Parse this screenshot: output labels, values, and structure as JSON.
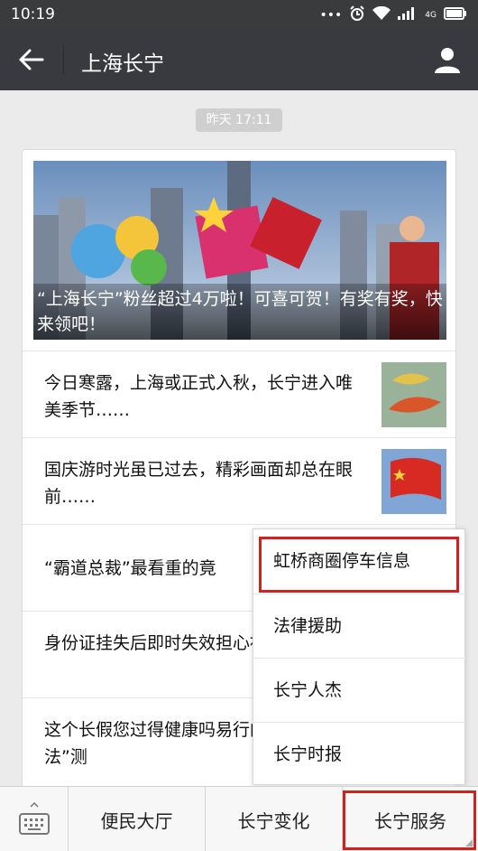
{
  "status_bar": {
    "time": "10:19",
    "icons": [
      "more-icon",
      "alarm-icon",
      "wifi-icon",
      "signal-icon",
      "battery-icon"
    ],
    "network": "4G"
  },
  "nav": {
    "title": "上海长宁"
  },
  "timestamp": "昨天 17:11",
  "banner": {
    "caption": "“上海长宁”粉丝超过4万啦！可喜可贺！有奖有奖，快来领吧！"
  },
  "articles": [
    {
      "title": "今日寒露，上海或正式入秋，长宁进入唯美季节……",
      "thumb": "autumn-leaf-thumbnail"
    },
    {
      "title": "国庆游时光虽已过去，精彩画面却总在眼前……",
      "thumb": "flag-thumbnail"
    },
    {
      "title": "“霸道总裁”最看重的竟"
    },
    {
      "title": "身份证挂失后即时失效担心被冒用啦~"
    },
    {
      "title": "这个长假您过得健康吗易行的“身体自检法”测"
    }
  ],
  "popup_menu": {
    "items": [
      "虹桥商圈停车信息",
      "法律援助",
      "长宁人杰",
      "长宁时报"
    ],
    "highlighted": 0
  },
  "bottom_menu": {
    "items": [
      "便民大厅",
      "长宁变化",
      "长宁服务"
    ],
    "highlighted": 2
  },
  "colors": {
    "nav_bg": "#393a3f",
    "highlight": "#d0211c",
    "background": "#ebebeb"
  }
}
